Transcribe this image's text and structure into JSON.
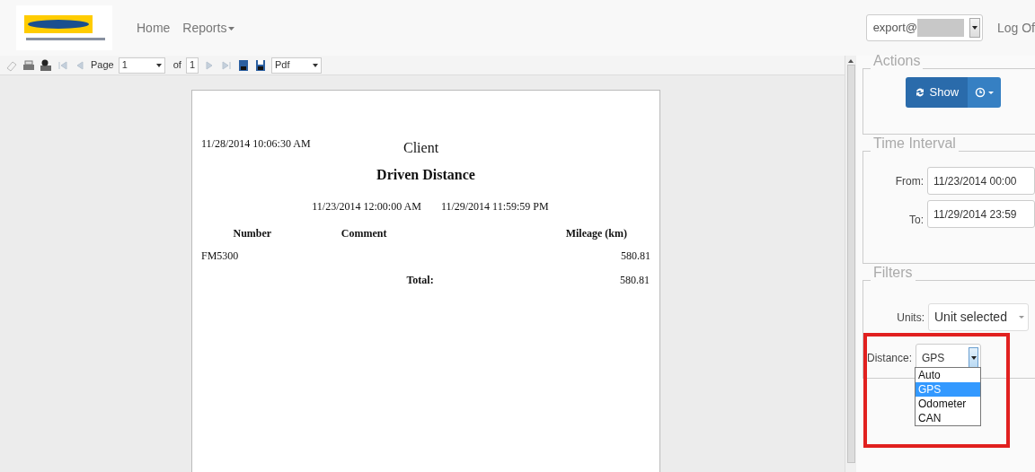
{
  "header": {
    "nav": [
      {
        "label": "Home",
        "has_caret": false
      },
      {
        "label": "Reports",
        "has_caret": true
      }
    ],
    "account": {
      "value": "export@",
      "redacted": true
    },
    "logout": "Log Of"
  },
  "toolbar": {
    "page_label": "Page",
    "page": "1",
    "of_label": "of",
    "page_count": "1",
    "format": "Pdf"
  },
  "report": {
    "timestamp": "11/28/2014 10:06:30 AM",
    "client": "Client",
    "title": "Driven Distance",
    "range_from": "11/23/2014 12:00:00 AM",
    "range_to": "11/29/2014 11:59:59 PM",
    "columns": [
      "Number",
      "Comment",
      "Mileage (km)"
    ],
    "rows": [
      {
        "number": "FM5300",
        "mileage": "580.81"
      }
    ],
    "total_label": "Total:",
    "total": "580.81"
  },
  "panel": {
    "actions": {
      "legend": "Actions",
      "show": "Show"
    },
    "time": {
      "legend": "Time Interval",
      "from_label": "From:",
      "from": "11/23/2014 00:00",
      "to_label": "To:",
      "to": "11/29/2014 23:59"
    },
    "filters": {
      "legend": "Filters",
      "units_label": "Units:",
      "units": "Unit selected",
      "distance_label": "Distance:",
      "distance": "GPS",
      "open": true,
      "highlighted": true,
      "options": [
        {
          "label": "Auto",
          "selected": false
        },
        {
          "label": "GPS",
          "selected": true
        },
        {
          "label": "Odometer",
          "selected": false
        },
        {
          "label": "CAN",
          "selected": false
        }
      ]
    }
  }
}
